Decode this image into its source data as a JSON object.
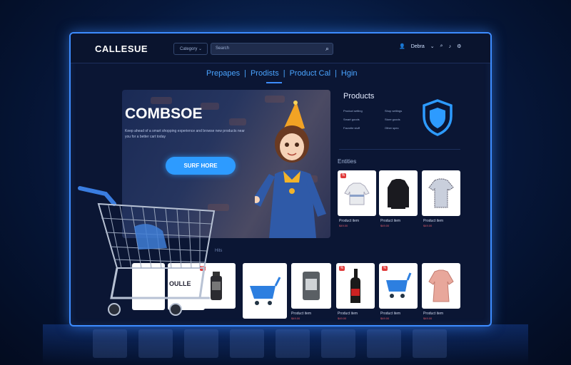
{
  "header": {
    "logo": "CALLESUE",
    "dropdown": "Category",
    "search_placeholder": "Search",
    "user_label": "Debra"
  },
  "nav": {
    "items": [
      "Prepapes",
      "Prodists",
      "Product Cal",
      "Hgin"
    ]
  },
  "hero": {
    "title": "COMBSOE",
    "description": "Keep ahead of a smart shopping experience and browse new products near you for a better cart today",
    "button": "SURF HORE"
  },
  "products_panel": {
    "title": "Products",
    "links": [
      "Product setting",
      "Shop settings",
      "Smart goods",
      "Store goods",
      "Favorite stuff",
      "Other spec"
    ]
  },
  "entities": {
    "title": "Entities",
    "items": [
      {
        "name": "Product item",
        "price": "$49.00",
        "icon": "sweater"
      },
      {
        "name": "Product item",
        "price": "$49.00",
        "icon": "jacket"
      },
      {
        "name": "Product item",
        "price": "$49.00",
        "icon": "shirt"
      }
    ]
  },
  "bottom_section": {
    "label": "Hits",
    "items": [
      {
        "name": "",
        "price": "",
        "icon": "bottle-small",
        "badge": true
      },
      {
        "name": "",
        "price": "",
        "icon": "blue-cart",
        "badge": false
      },
      {
        "name": "Product item",
        "price": "$49.00",
        "icon": "bag",
        "badge": false
      },
      {
        "name": "Product item",
        "price": "$49.00",
        "icon": "wine-bottle",
        "badge": true
      },
      {
        "name": "Product item",
        "price": "$49.00",
        "icon": "blue-cart",
        "badge": true
      },
      {
        "name": "Product item",
        "price": "$49.00",
        "icon": "blouse",
        "badge": false
      }
    ],
    "overlay_text": "OULLE"
  },
  "colors": {
    "accent": "#2d9bff",
    "border_glow": "#3d8cff",
    "panel_bg": "#0b1634",
    "badge": "#e03a3a"
  }
}
